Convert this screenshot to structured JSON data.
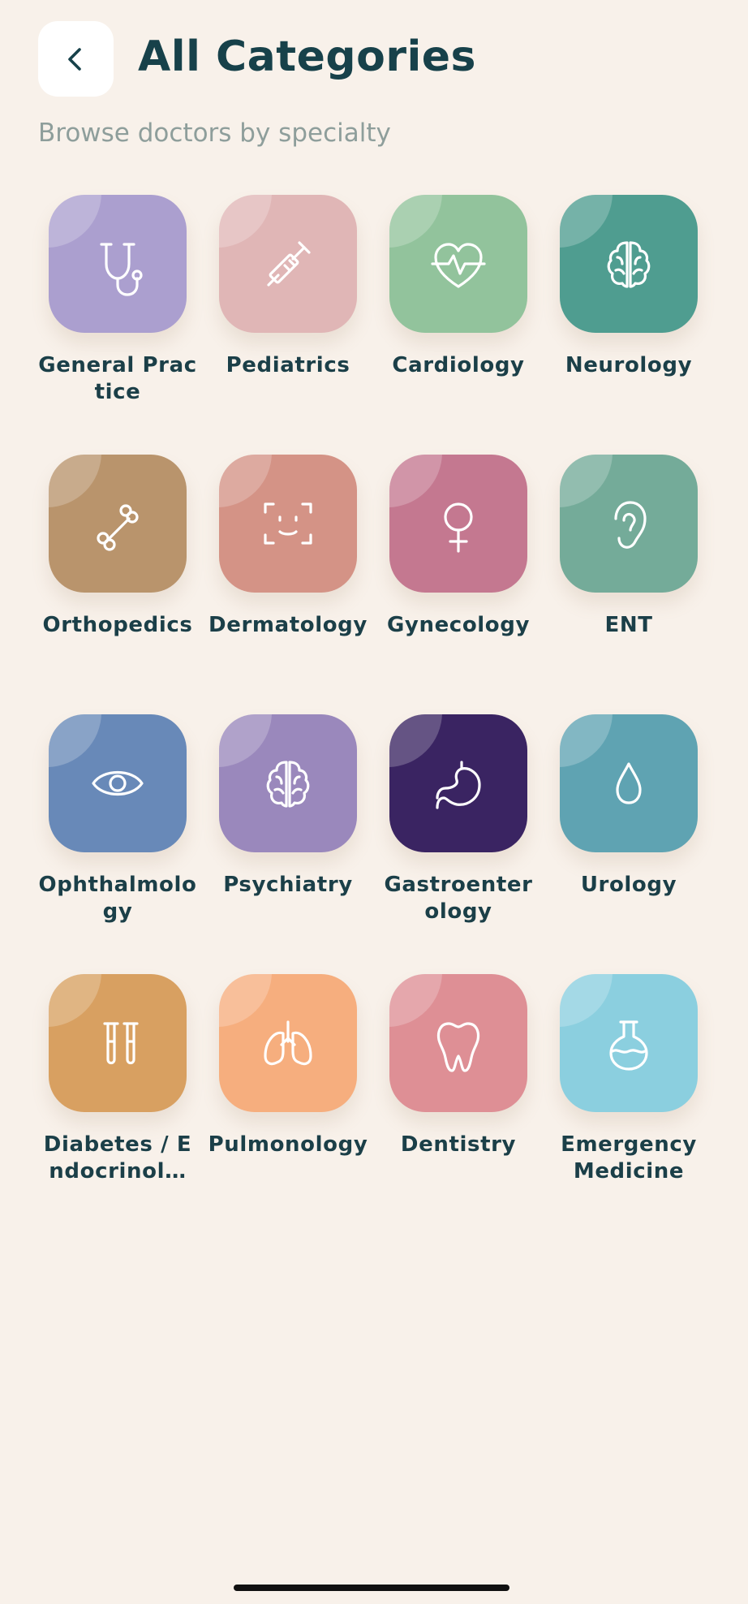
{
  "header": {
    "title": "All Categories",
    "subtitle": "Browse doctors by specialty",
    "back_icon": "chevron-left-icon"
  },
  "categories": [
    {
      "id": "general-practice",
      "label": "General Practice",
      "icon": "stethoscope-icon",
      "color": "#ab9fcf"
    },
    {
      "id": "pediatrics",
      "label": "Pediatrics",
      "icon": "syringe-icon",
      "color": "#e0b6b6"
    },
    {
      "id": "cardiology",
      "label": "Cardiology",
      "icon": "heart-pulse-icon",
      "color": "#92c39c"
    },
    {
      "id": "neurology",
      "label": "Neurology",
      "icon": "brain-icon",
      "color": "#4f9d90"
    },
    {
      "id": "orthopedics",
      "label": "Orthopedics",
      "icon": "bone-icon",
      "color": "#b9946c"
    },
    {
      "id": "dermatology",
      "label": "Dermatology",
      "icon": "face-scan-icon",
      "color": "#d49386"
    },
    {
      "id": "gynecology",
      "label": "Gynecology",
      "icon": "female-symbol-icon",
      "color": "#c47890"
    },
    {
      "id": "ent",
      "label": "ENT",
      "icon": "ear-icon",
      "color": "#74ab99"
    },
    {
      "id": "ophthalmology",
      "label": "Ophthalmology",
      "icon": "eye-icon",
      "color": "#6889b8"
    },
    {
      "id": "psychiatry",
      "label": "Psychiatry",
      "icon": "brain-icon",
      "color": "#9a88bc"
    },
    {
      "id": "gastroenterology",
      "label": "Gastroenterology",
      "icon": "stomach-icon",
      "color": "#3a2462"
    },
    {
      "id": "urology",
      "label": "Urology",
      "icon": "droplet-icon",
      "color": "#5fa3b2"
    },
    {
      "id": "diabetes-endocrinology",
      "label": "Diabetes / Endocrinol…",
      "icon": "test-tubes-icon",
      "color": "#d8a061"
    },
    {
      "id": "pulmonology",
      "label": "Pulmonology",
      "icon": "lungs-icon",
      "color": "#f6ae7e"
    },
    {
      "id": "dentistry",
      "label": "Dentistry",
      "icon": "tooth-icon",
      "color": "#de8f95"
    },
    {
      "id": "emergency-medicine",
      "label": "Emergency Medicine",
      "icon": "flask-icon",
      "color": "#8bcfdf"
    }
  ]
}
